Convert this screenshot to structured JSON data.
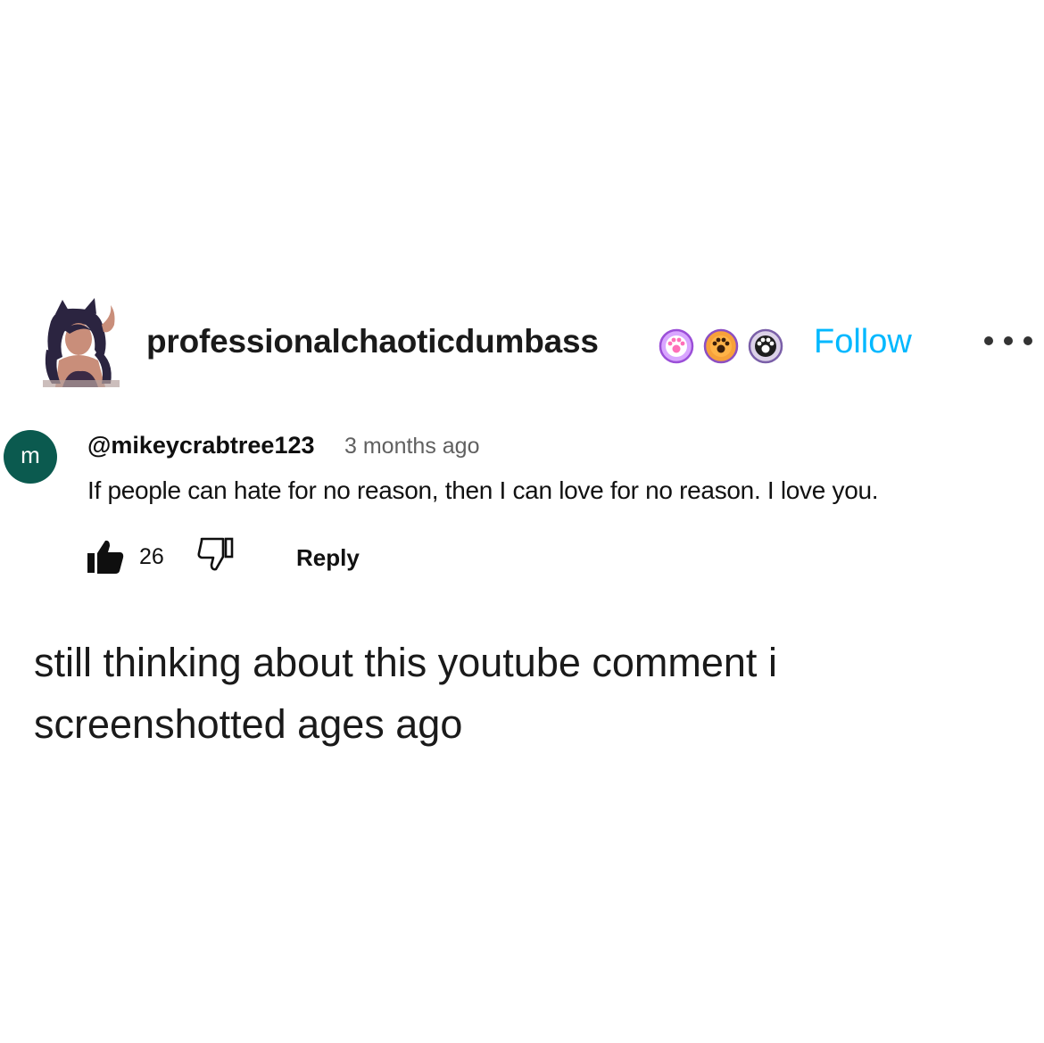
{
  "post": {
    "username": "professionalchaoticdumbass",
    "follow_label": "Follow",
    "badges": [
      {
        "icon": "pink-paw-badge-icon",
        "color": "#c86cf0"
      },
      {
        "icon": "orange-paw-badge-icon",
        "color": "#f08a1a"
      },
      {
        "icon": "black-paw-badge-icon",
        "color": "#222222"
      }
    ],
    "text": "still thinking about this youtube comment i screenshotted ages ago"
  },
  "comment": {
    "avatar_letter": "m",
    "handle": "@mikeycrabtree123",
    "time": "3 months ago",
    "text": "If people can hate for no reason, then I can love for no reason. I love you.",
    "likes": "26",
    "reply_label": "Reply"
  },
  "colors": {
    "follow": "#00b8ff",
    "comment_avatar": "#0b5a4f",
    "time": "#606060"
  }
}
